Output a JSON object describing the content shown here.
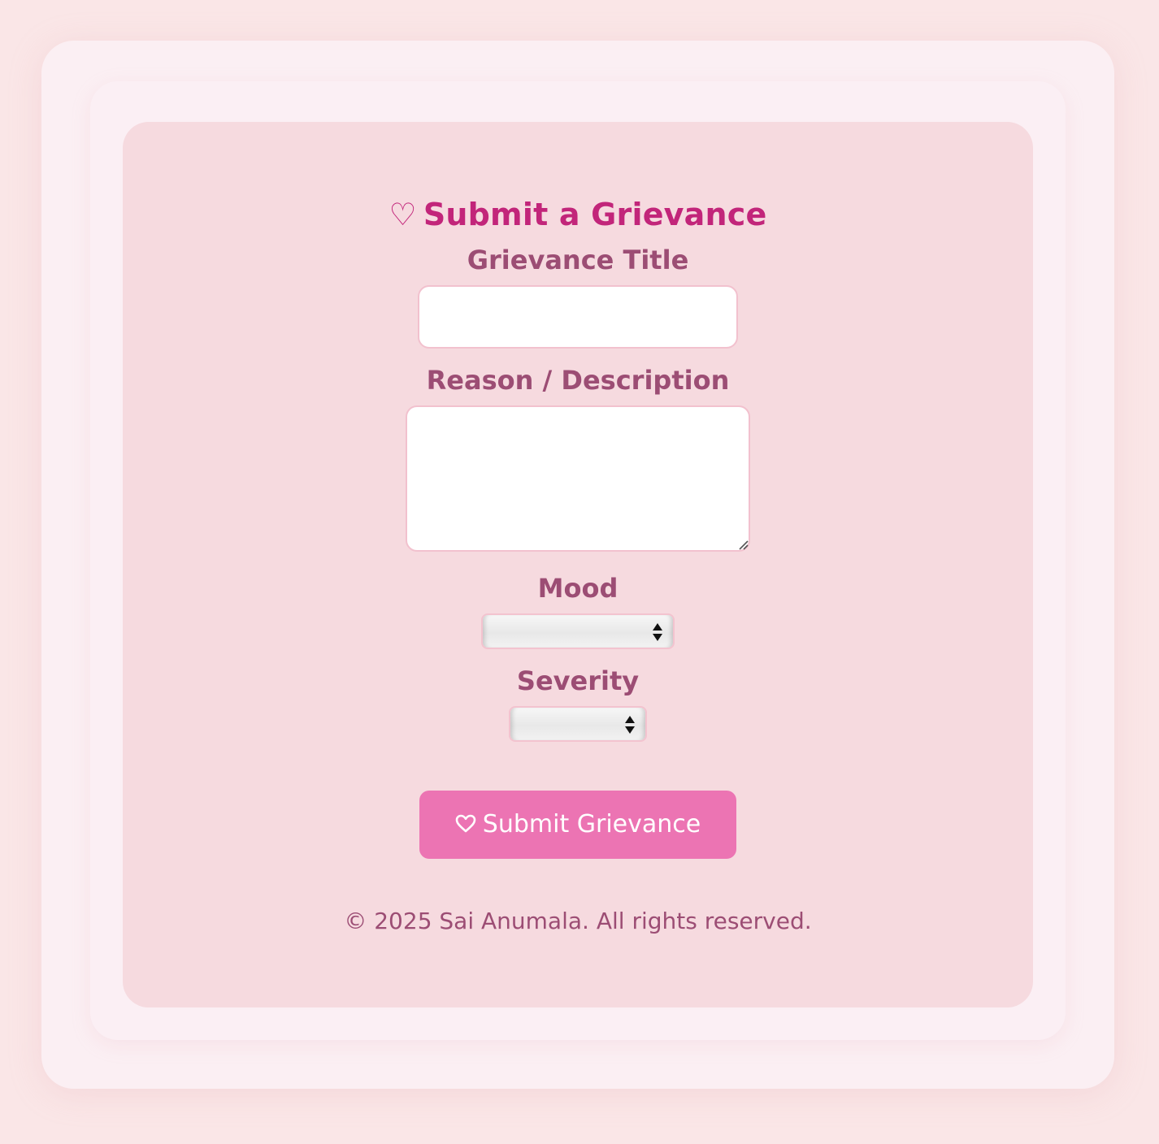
{
  "form": {
    "heading": "Submit a Grievance",
    "heading_icon": "heart-outline-icon",
    "title_label": "Grievance Title",
    "title_value": "",
    "reason_label": "Reason / Description",
    "reason_value": "",
    "mood_label": "Mood",
    "mood_value": "",
    "severity_label": "Severity",
    "severity_value": "",
    "submit_label": "Submit Grievance",
    "submit_icon": "heart-outline-icon"
  },
  "footer": {
    "copyright": "© 2025 Sai Anumala. All rights reserved."
  },
  "colors": {
    "background": "#fae6e7",
    "card": "#f6dadf",
    "heading": "#c2257a",
    "label": "#9c4d74",
    "button": "#ec74b3",
    "field_border": "#f2c1ce"
  }
}
